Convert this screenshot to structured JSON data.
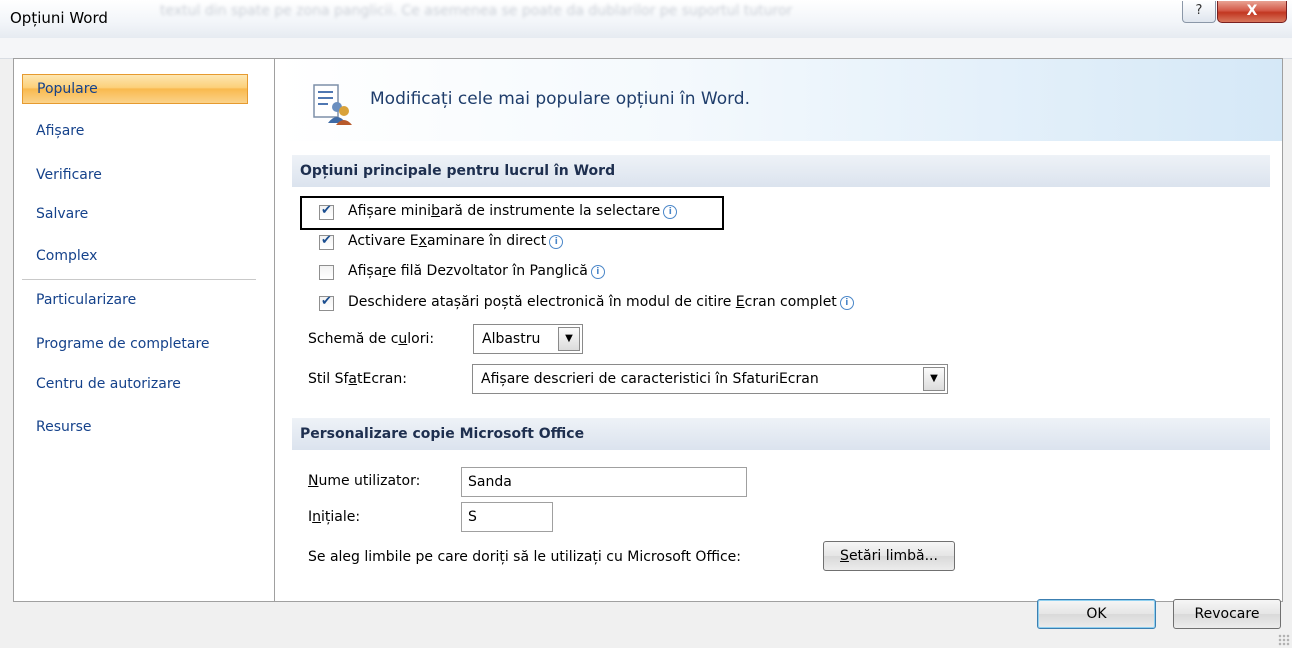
{
  "window": {
    "title": "Opțiuni Word",
    "ghost_text": "textul din spate pe zona panglicii. Ce asemenea se poate da dublarilor pe suportul tuturor",
    "help_label": "?",
    "close_label": "X"
  },
  "sidebar": {
    "items": [
      {
        "label": "Populare",
        "active": true
      },
      {
        "label": "Afișare"
      },
      {
        "label": "Verificare"
      },
      {
        "label": "Salvare"
      },
      {
        "label": "Complex"
      },
      {
        "label": "Particularizare"
      },
      {
        "label": "Programe de completare"
      },
      {
        "label": "Centru de autorizare"
      },
      {
        "label": "Resurse"
      }
    ]
  },
  "header": {
    "text": "Modificați cele mai populare opțiuni în Word.",
    "icon": "popular-options-icon"
  },
  "section1": {
    "title": "Opțiuni principale pentru lucrul în Word",
    "options": [
      {
        "pre": "Afișare mini",
        "key": "b",
        "post": "ară de instrumente la selectare",
        "checked": true
      },
      {
        "pre": "Activare E",
        "key": "x",
        "post": "aminare în direct",
        "checked": true
      },
      {
        "pre": "Afișa",
        "key": "r",
        "post": "e filă Dezvoltator în Panglică",
        "checked": false
      },
      {
        "pre": "Deschidere atașări poștă electronică în modul de citire ",
        "key": "E",
        "post": "cran complet",
        "checked": true
      }
    ],
    "color_scheme": {
      "pre": "Schemă de c",
      "key": "u",
      "post": "lori:",
      "value": "Albastru"
    },
    "screentip": {
      "pre": "Stil Sf",
      "key": "a",
      "post": "tEcran:",
      "value": "Afișare descrieri de caracteristici în SfaturiEcran"
    }
  },
  "section2": {
    "title": "Personalizare copie Microsoft Office",
    "username": {
      "key": "N",
      "post": "ume utilizator:",
      "value": "Sanda"
    },
    "initials": {
      "pre": "I",
      "key": "n",
      "post": "ițiale:",
      "value": "S"
    },
    "language_text": "Se aleg limbile pe care doriți să le utilizați cu Microsoft Office:",
    "language_button": {
      "key": "S",
      "post": "etări limbă..."
    }
  },
  "footer": {
    "ok_label": "OK",
    "cancel_label": "Revocare"
  },
  "colors": {
    "accent_active": "#f9b94e",
    "nav_text": "#15428b",
    "section_bg": "#dbe3ee"
  }
}
